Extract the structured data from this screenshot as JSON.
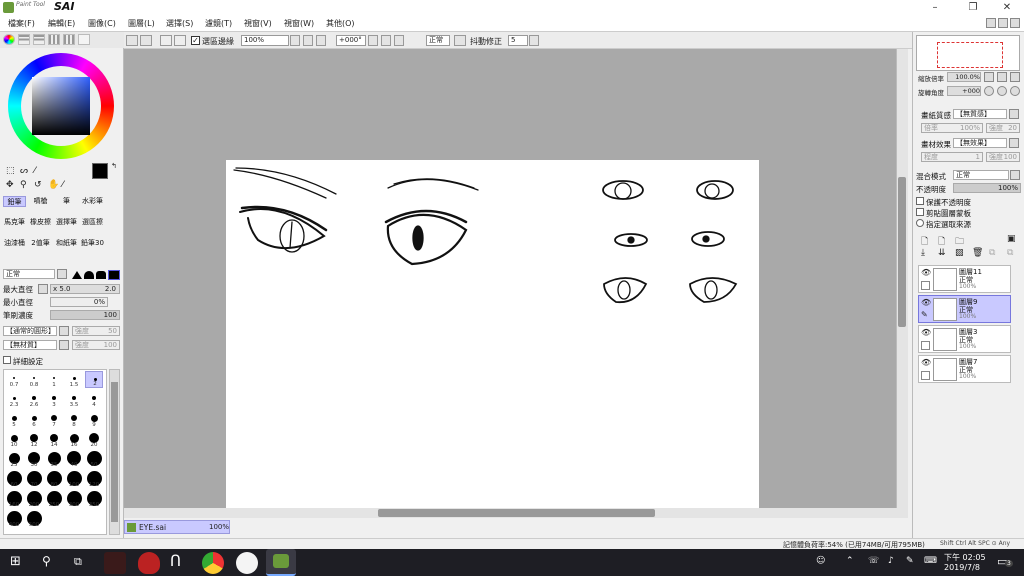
{
  "app": {
    "logo_text": "Paint Tool",
    "logo_sai": "SAI"
  },
  "window_controls": [
    "–",
    "❐",
    "✕"
  ],
  "menu": [
    "檔案(F)",
    "編輯(E)",
    "圖像(C)",
    "圖層(L)",
    "選擇(S)",
    "濾鏡(T)",
    "視窗(V)",
    "視窗(W)",
    "其他(O)"
  ],
  "toolbar": {
    "selection_edge_label": "選區邊緣",
    "zoom": "100%",
    "rotation": "+000°",
    "blend_mode": "正常",
    "stabilizer_label": "抖動修正",
    "stabilizer_value": "5"
  },
  "tools": {
    "rows": [
      [
        "鉛筆",
        "噴槍",
        "筆",
        "水彩筆"
      ],
      [
        "馬克筆",
        "橡皮擦",
        "選擇筆",
        "選區擦"
      ],
      [
        "油漆桶",
        "2值筆",
        "和紙筆",
        "鉛筆30"
      ]
    ]
  },
  "brush": {
    "mode": "正常",
    "max_size_label": "最大直徑",
    "max_size_mult": "x 5.0",
    "max_size_value": "2.0",
    "min_size_label": "最小直徑",
    "min_size_value": "0%",
    "density_label": "筆刷濃度",
    "density_value": "100",
    "shape": "【通常的圓形】",
    "shape_strength_label": "強度",
    "shape_strength": "50",
    "texture": "【無材質】",
    "texture_strength_label": "強度",
    "texture_strength": "100",
    "detail_label": "詳細設定",
    "sizes": [
      "0.7",
      "0.8",
      "1",
      "1.5",
      "2",
      "2.3",
      "2.6",
      "3",
      "3.5",
      "4",
      "5",
      "6",
      "7",
      "8",
      "9",
      "10",
      "12",
      "14",
      "16",
      "20",
      "25",
      "30",
      "35",
      "40",
      "50",
      "60",
      "70",
      "80",
      "100",
      "120",
      "160",
      "200",
      "250",
      "300",
      "350",
      "400",
      "500"
    ]
  },
  "canvas": {
    "file_name": "EYE.sai",
    "file_zoom": "100%"
  },
  "navigator": {
    "zoom_label": "縮放倍率",
    "zoom_value": "100.0%",
    "angle_label": "旋轉角度",
    "angle_value": "+000"
  },
  "texture_panel": {
    "paper_label": "畫紙質感",
    "paper_value": "【無質感】",
    "scale_label": "倍率",
    "scale_value": "100%",
    "strength_label": "強度",
    "strength_value": "20",
    "effect_label": "畫材效果",
    "effect_value": "【無效果】",
    "degree_label": "程度",
    "degree_value": "1",
    "width_label": "強度",
    "width_value": "100"
  },
  "layer_props": {
    "blend_label": "混合模式",
    "blend_value": "正常",
    "opacity_label": "不透明度",
    "opacity_value": "100%",
    "preserve_label": "保護不透明度",
    "clip_label": "剪貼圖層蒙板",
    "source_label": "指定選取來源"
  },
  "layers": [
    {
      "name": "圖層11",
      "mode": "正常",
      "opacity": "100%",
      "selected": false
    },
    {
      "name": "圖層9",
      "mode": "正常",
      "opacity": "100%",
      "selected": true
    },
    {
      "name": "圖層3",
      "mode": "正常",
      "opacity": "100%",
      "selected": false
    },
    {
      "name": "圖層7",
      "mode": "正常",
      "opacity": "100%",
      "selected": false
    }
  ],
  "status": {
    "memory": "記憶體負荷率:54% (已用74MB/可用795MB)",
    "keys": "Shift Ctrl Alt SPC ⊙ Any"
  },
  "taskbar": {
    "time": "下午 02:05",
    "date": "2019/7/8",
    "notif_count": "3"
  }
}
